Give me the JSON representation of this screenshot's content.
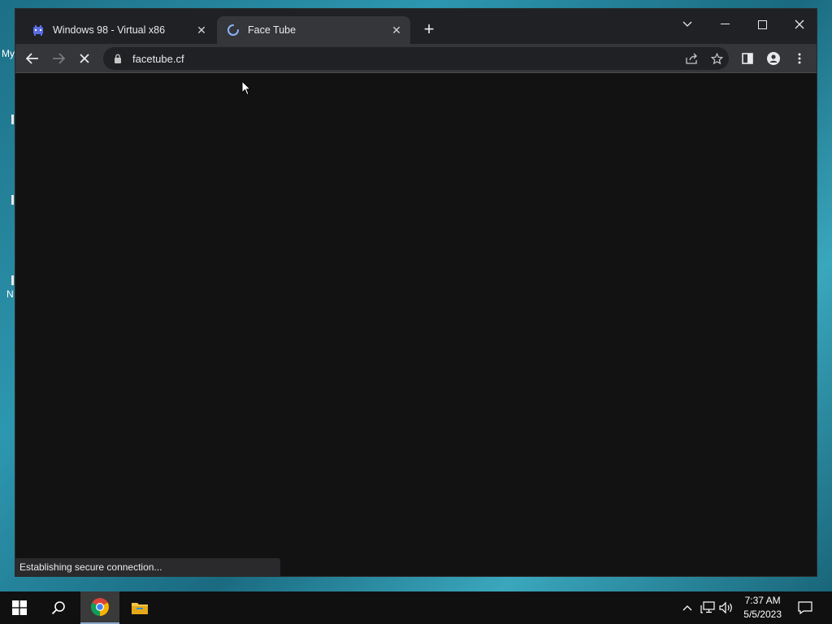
{
  "desktop": {
    "fragments": [
      "My",
      "N"
    ]
  },
  "browser": {
    "tabs": [
      {
        "title": "Windows 98 - Virtual x86",
        "active": false,
        "favicon": "pixel-monster-icon"
      },
      {
        "title": "Face Tube",
        "active": true,
        "favicon": "loading-spinner-icon"
      }
    ],
    "address": {
      "url": "facetube.cf"
    },
    "status_text": "Establishing secure connection...",
    "colors": {
      "frame": "#202124",
      "toolbar": "#35363a",
      "page": "#121212"
    }
  },
  "taskbar": {
    "time": "7:37 AM",
    "date": "5/5/2023"
  }
}
